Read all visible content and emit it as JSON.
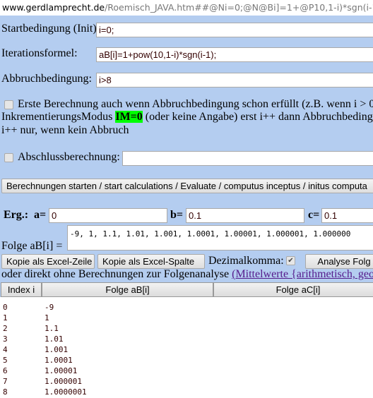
{
  "url": {
    "domain": "www.gerdlamprecht.de",
    "path": "/Roemisch_JAVA.htm##@Ni=0;@N@Bi]=1+@P10,1-i)*sgn(i-1"
  },
  "form": {
    "init_label": "Startbedingung (Init)",
    "init_value": "i=0;",
    "iter_label": "Iterationsformel:",
    "iter_value": "aB[i]=1+pow(10,1-i)*sgn(i-1);",
    "stop_label": "Abbruchbedingung:",
    "stop_value": "i>8",
    "first_calc_text": "Erste Berechnung auch wenn Abbruchbedingung schon erfüllt (z.B. wenn i > 0",
    "im_prefix": "InkrementierungsModus ",
    "im_value": "IM=0",
    "im_suffix": " (oder keine Angabe) erst i++ dann Abbruchbeding",
    "im_line2": "i++ nur, wenn kein Abbruch",
    "final_label": "Abschlussberechnung:",
    "final_value": "",
    "start_button": "Berechnungen starten / start calculations / Evaluate / computus inceptus / initus computa"
  },
  "results": {
    "erg_label": "Erg.:",
    "a_label": "a=",
    "a_value": "0",
    "b_label": "b=",
    "b_value": "0.1",
    "c_label": "c=",
    "c_value": "0.1",
    "seq_label": "Folge aB[i] =",
    "seq_value": "-9, 1, 1.1, 1.01, 1.001, 1.0001, 1.00001, 1.000001, 1.000000",
    "copy_row": "Kopie als Excel-Zeile",
    "copy_col": "Kopie als Excel-Spalte",
    "decimal_label": "Dezimalkomma:",
    "decimal_checked": true,
    "analyse_button": "Analyse Folg",
    "direct_text": "oder direkt ohne Berechnungen zur Folgenanalyse ",
    "direct_link": "(Mittelwerte {arithmetisch, geo"
  },
  "table": {
    "headers": [
      "Index i",
      "Folge aB[i]",
      "Folge aC[i]"
    ],
    "rows": [
      [
        "0",
        "-9"
      ],
      [
        "1",
        "1"
      ],
      [
        "2",
        "1.1"
      ],
      [
        "3",
        "1.01"
      ],
      [
        "4",
        "1.001"
      ],
      [
        "5",
        "1.0001"
      ],
      [
        "6",
        "1.00001"
      ],
      [
        "7",
        "1.000001"
      ],
      [
        "8",
        "1.0000001"
      ]
    ]
  }
}
